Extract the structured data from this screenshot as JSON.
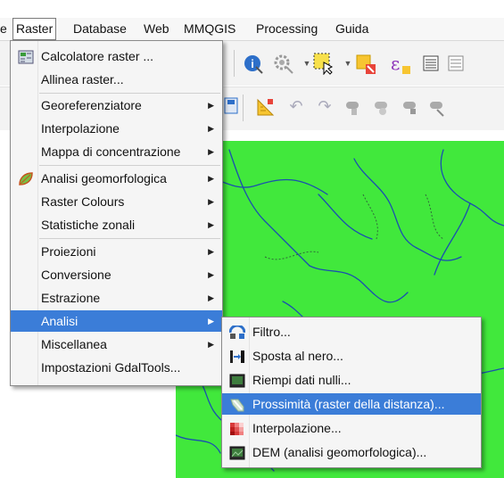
{
  "menubar": {
    "items": [
      {
        "label": "e"
      },
      {
        "label": "Raster"
      },
      {
        "label": "Database"
      },
      {
        "label": "Web"
      },
      {
        "label": "MMQGIS"
      },
      {
        "label": "Processing"
      },
      {
        "label": "Guida"
      }
    ]
  },
  "raster_menu": {
    "items": [
      {
        "label": "Calcolatore raster ...",
        "icon": "calculator-icon"
      },
      {
        "label": "Allinea raster..."
      },
      {
        "label": "Georeferenziatore",
        "submenu": "▶"
      },
      {
        "label": "Interpolazione",
        "submenu": "▶"
      },
      {
        "label": "Mappa di concentrazione",
        "submenu": "▶"
      },
      {
        "label": "Analisi geomorfologica",
        "icon": "leaf-icon",
        "submenu": "▶"
      },
      {
        "label": "Raster Colours",
        "submenu": "▶"
      },
      {
        "label": "Statistiche zonali",
        "submenu": "▶"
      },
      {
        "label": "Proiezioni",
        "submenu": "▶"
      },
      {
        "label": "Conversione",
        "submenu": "▶"
      },
      {
        "label": "Estrazione",
        "submenu": "▶"
      },
      {
        "label": "Analisi",
        "submenu": "▶"
      },
      {
        "label": "Miscellanea",
        "submenu": "▶"
      },
      {
        "label": "Impostazioni GdalTools..."
      }
    ],
    "selected": "Analisi"
  },
  "analisi_menu": {
    "items": [
      {
        "label": "Filtro...",
        "icon": "filter-icon"
      },
      {
        "label": "Sposta al nero...",
        "icon": "nearblack-icon"
      },
      {
        "label": "Riempi dati nulli...",
        "icon": "fill-nodata-icon"
      },
      {
        "label": "Prossimità (raster della distanza)...",
        "icon": "proximity-icon"
      },
      {
        "label": "Interpolazione...",
        "icon": "grid-icon"
      },
      {
        "label": "DEM (analisi geomorfologica)...",
        "icon": "dem-icon"
      }
    ],
    "selected": "Prossimità (raster della distanza)..."
  },
  "colors": {
    "highlight": "#3b7dd8",
    "map_background": "#41e83c",
    "rivers": "#1a4fb0"
  }
}
